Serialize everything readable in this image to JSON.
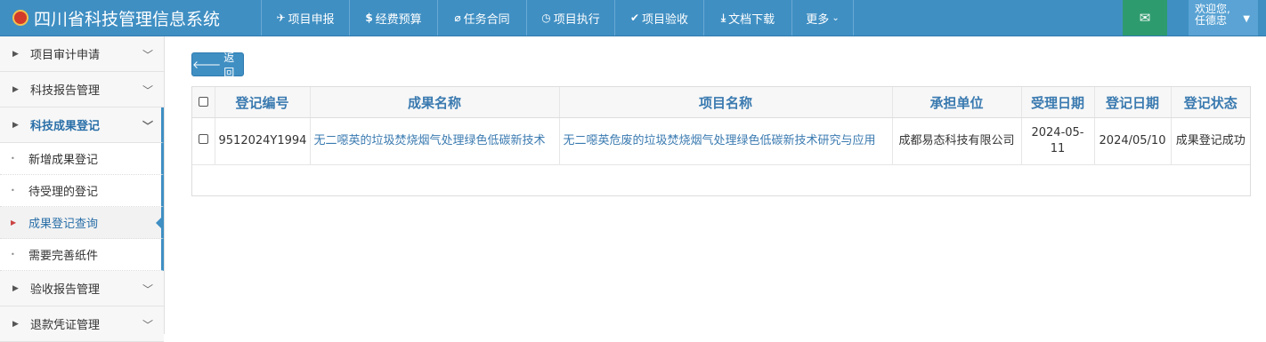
{
  "app": {
    "title": "四川省科技管理信息系统",
    "brand_color": "#3f8fc3"
  },
  "nav": [
    {
      "icon": "paper-plane-icon",
      "glyph": "✈",
      "label": "项目申报"
    },
    {
      "icon": "dollar-icon",
      "glyph": "$",
      "label": "经费预算"
    },
    {
      "icon": "paperclip-icon",
      "glyph": "⌀",
      "label": "任务合同"
    },
    {
      "icon": "clock-icon",
      "glyph": "◷",
      "label": "项目执行"
    },
    {
      "icon": "check-icon",
      "glyph": "✔",
      "label": "项目验收"
    },
    {
      "icon": "download-icon",
      "glyph": "⤓",
      "label": "文档下载"
    },
    {
      "icon": "",
      "glyph": "",
      "label": "更多"
    }
  ],
  "user": {
    "greeting": "欢迎您,",
    "name": "任德忠"
  },
  "sidebar": {
    "groups": [
      {
        "label": "项目审计申请"
      },
      {
        "label": "科技报告管理"
      },
      {
        "label": "科技成果登记"
      }
    ],
    "sub_items": [
      {
        "label": "新增成果登记"
      },
      {
        "label": "待受理的登记"
      },
      {
        "label": "成果登记查询"
      },
      {
        "label": "需要完善纸件"
      }
    ],
    "groups_after": [
      {
        "label": "验收报告管理"
      },
      {
        "label": "退款凭证管理"
      }
    ]
  },
  "main": {
    "back_label": "返回",
    "table": {
      "headers": [
        "登记编号",
        "成果名称",
        "项目名称",
        "承担单位",
        "受理日期",
        "登记日期",
        "登记状态"
      ],
      "rows": [
        {
          "reg_no": "9512024Y1994",
          "result_name": "无二噁英的垃圾焚烧烟气处理绿色低碳新技术",
          "project_name": "无二噁英危废的垃圾焚烧烟气处理绿色低碳新技术研究与应用",
          "unit": "成都易态科技有限公司",
          "accept_date": "2024-05-11",
          "reg_date": "2024/05/10",
          "status": "成果登记成功"
        }
      ]
    }
  }
}
